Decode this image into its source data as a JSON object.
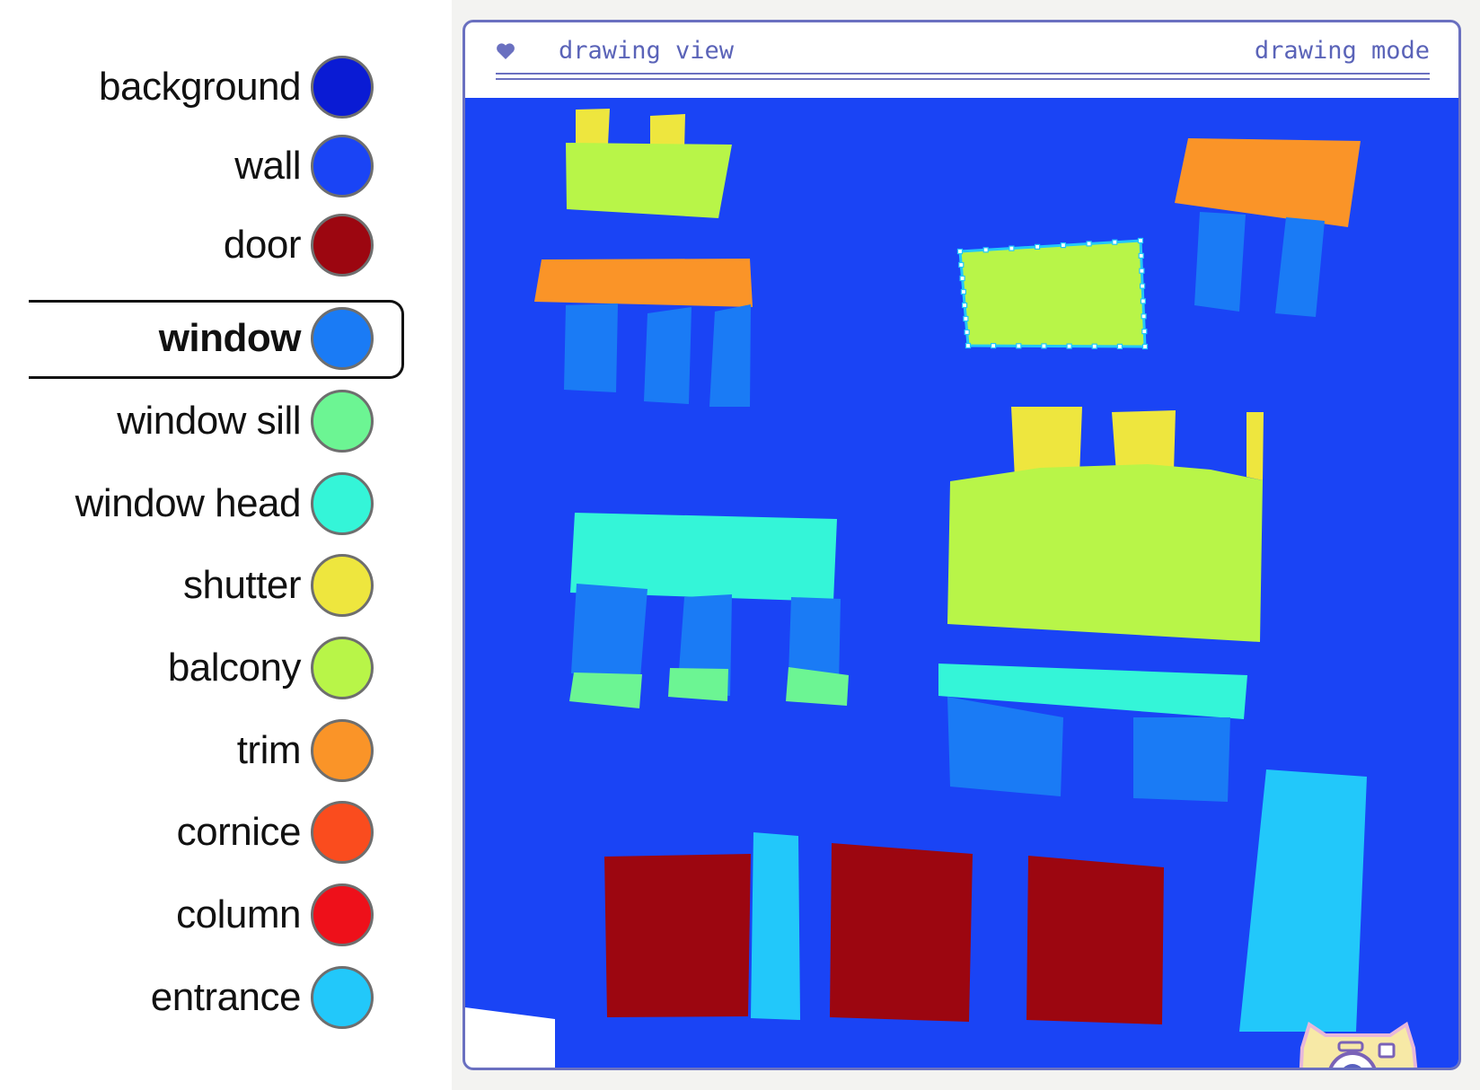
{
  "legend": {
    "selected": "window",
    "items": [
      {
        "label": "background",
        "color": "#0a1bd4"
      },
      {
        "label": "wall",
        "color": "#1a44f5"
      },
      {
        "label": "door",
        "color": "#9c0610"
      },
      {
        "label": "window",
        "color": "#1a7bf5"
      },
      {
        "label": "window sill",
        "color": "#6cf593"
      },
      {
        "label": "window head",
        "color": "#34f5d8"
      },
      {
        "label": "shutter",
        "color": "#eee63e"
      },
      {
        "label": "balcony",
        "color": "#b8f548"
      },
      {
        "label": "trim",
        "color": "#fa9428"
      },
      {
        "label": "cornice",
        "color": "#fa4c1e"
      },
      {
        "label": "column",
        "color": "#ee101a"
      },
      {
        "label": "entrance",
        "color": "#22c8fa"
      }
    ]
  },
  "panel": {
    "title": "drawing view",
    "mode": "drawing mode",
    "title_icon": "heart-icon",
    "camera_icon": "camera-icon"
  },
  "colors": {
    "accent": "#6a70c0",
    "canvas_background": "#1a44f5"
  }
}
